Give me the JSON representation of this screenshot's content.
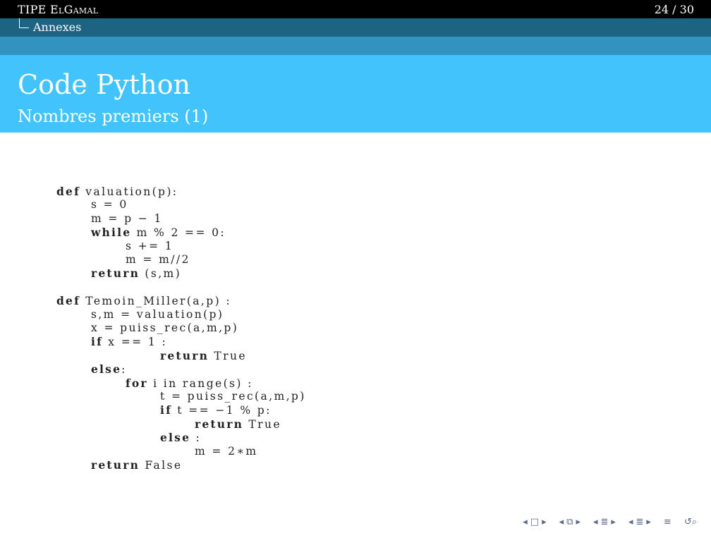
{
  "header": {
    "title": "TIPE ElGamal",
    "page": "24 / 30",
    "section": "Annexes"
  },
  "frame": {
    "title": "Code Python",
    "subtitle": "Nombres premiers (1)"
  },
  "code_lines": [
    {
      "indent": 0,
      "kw": "def",
      "text": " valuation(p):"
    },
    {
      "indent": 1,
      "kw": "",
      "text": "s = 0"
    },
    {
      "indent": 1,
      "kw": "",
      "text": "m = p − 1"
    },
    {
      "indent": 1,
      "kw": "while",
      "text": " m % 2 == 0:"
    },
    {
      "indent": 2,
      "kw": "",
      "text": "s += 1"
    },
    {
      "indent": 2,
      "kw": "",
      "text": "m = m//2"
    },
    {
      "indent": 1,
      "kw": "return",
      "text": " (s,m)"
    },
    {
      "indent": 0,
      "kw": "",
      "text": ""
    },
    {
      "indent": 0,
      "kw": "def",
      "text": " Temoin_Miller(a,p) :"
    },
    {
      "indent": 1,
      "kw": "",
      "text": "s,m = valuation(p)"
    },
    {
      "indent": 1,
      "kw": "",
      "text": "x = puiss_rec(a,m,p)"
    },
    {
      "indent": 1,
      "kw": "if",
      "text": " x == 1 :"
    },
    {
      "indent": 3,
      "kw": "return",
      "text": " True"
    },
    {
      "indent": 1,
      "kw": "else",
      "text": ":"
    },
    {
      "indent": 2,
      "kw": "for",
      "text": " i in range(s) :"
    },
    {
      "indent": 3,
      "kw": "",
      "text": "t = puiss_rec(a,m,p)"
    },
    {
      "indent": 3,
      "kw": "if",
      "text": " t == −1 % p:"
    },
    {
      "indent": 4,
      "kw": "return",
      "text": " True"
    },
    {
      "indent": 3,
      "kw": "else",
      "text": " :"
    },
    {
      "indent": 4,
      "kw": "",
      "text": "m = 2∗m"
    },
    {
      "indent": 1,
      "kw": "return",
      "text": " False"
    }
  ],
  "nav": {
    "icons": [
      "nav-prev-frame",
      "nav-frame",
      "nav-next-frame",
      "nav-prev-subsection",
      "nav-subsection",
      "nav-next-subsection",
      "nav-prev-section",
      "nav-section",
      "nav-next-section",
      "nav-prev-part",
      "nav-part",
      "nav-next-part",
      "nav-align",
      "nav-search"
    ]
  },
  "colors": {
    "topbar": "#000000",
    "section_bar": "#1f6383",
    "strip": "#3293c0",
    "frame_header": "#42c3fb"
  }
}
